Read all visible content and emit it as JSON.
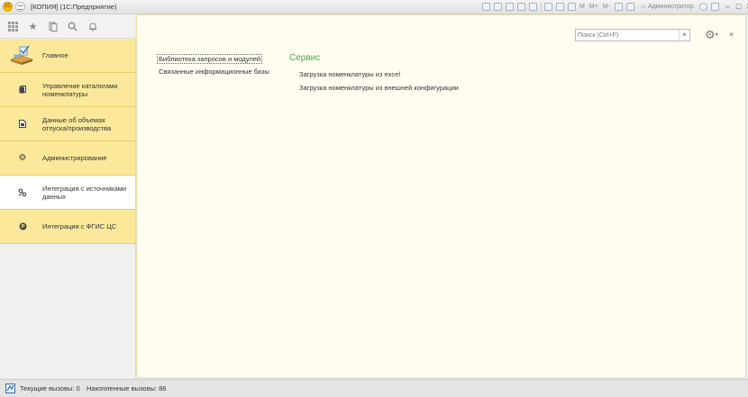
{
  "window": {
    "title": "[КОПИЯ]  (1С:Предприятие)",
    "logo_text": "1С",
    "toolbar_labels": [
      "M",
      "M+",
      "M-"
    ],
    "user": "Администратор",
    "controls": {
      "minimize": "–",
      "maximize": "□",
      "close": "✕"
    }
  },
  "topbar": {
    "icons": [
      "apps-grid-icon",
      "favorites-star-icon",
      "history-icon",
      "search-icon",
      "notifications-bell-icon"
    ]
  },
  "sections": [
    {
      "label": "Главное",
      "icon": "main-desk-icon",
      "active": false
    },
    {
      "label": "Управление каталогами номенклатуры",
      "icon": "catalog-icon",
      "active": false
    },
    {
      "label": "Данные об объемах отпуска/производства",
      "icon": "document-icon",
      "active": false
    },
    {
      "label": "Администрирование",
      "icon": "gear-icon",
      "active": false
    },
    {
      "label": "Интеграция с источниками данных",
      "icon": "integration-icon",
      "active": true
    },
    {
      "label": "Интеграция с ФГИС ЦС",
      "icon": "fgis-icon",
      "active": false
    }
  ],
  "content": {
    "search_placeholder": "Поиск (Ctrl+F)",
    "search_clear": "×",
    "left_links": [
      "Библиотека запросов и модулей",
      "Связанные информационные базы"
    ],
    "group_title": "Сервис",
    "service_links": [
      "Загрузка номенклатуры из excel",
      "Загрузка номенклатуры из внешней конфигурации"
    ],
    "close": "×"
  },
  "status": {
    "current_calls": "Текущие вызовы: 0",
    "accumulated_calls": "Накопленные вызовы: 86"
  },
  "colors": {
    "section_bg": "#fbe89b",
    "active_section_bg": "#ffffff",
    "content_bg": "#fffdf0",
    "group_title": "#4ca54c"
  }
}
